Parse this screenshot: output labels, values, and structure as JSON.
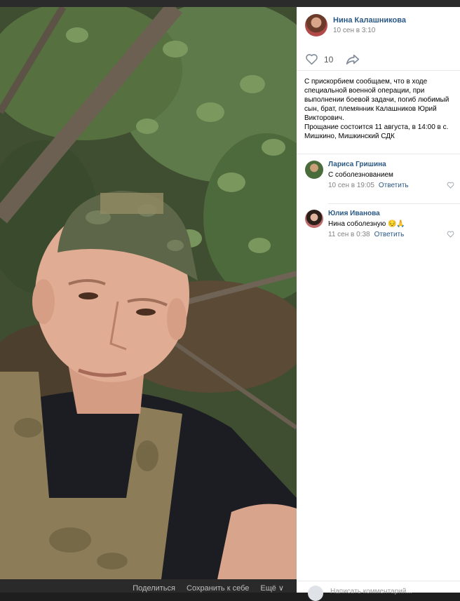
{
  "post": {
    "author_name": "Нина Калашникова",
    "date": "10 сен в 3:10",
    "like_count": "10",
    "text_paragraphs": [
      "С прискорбием сообщаем, что в ходе специальной военной операции, при выполнении боевой задачи, погиб любимый сын, брат, племянник Калашников Юрий Викторович.",
      "Прощание состоится 11 августа, в 14:00 в с. Мишкино, Мишкинский СДК"
    ]
  },
  "comments": [
    {
      "name": "Лариса Гришина",
      "text": "С соболезнованием",
      "date": "10 сен в 19:05",
      "reply_label": "Ответить"
    },
    {
      "name": "Юлия Иванова",
      "text": "Нина соболезную 😔🙏",
      "date": "11 сен в 0:38",
      "reply_label": "Ответить"
    }
  ],
  "photo_actions": {
    "share": "Поделиться",
    "save": "Сохранить к себе",
    "more": "Ещё ∨"
  },
  "compose": {
    "placeholder": "Написать комментарий..."
  },
  "colors": {
    "link": "#2a5885",
    "muted": "#828282",
    "panel_bg": "#ffffff",
    "photo_bar": "#2a2a2a"
  }
}
